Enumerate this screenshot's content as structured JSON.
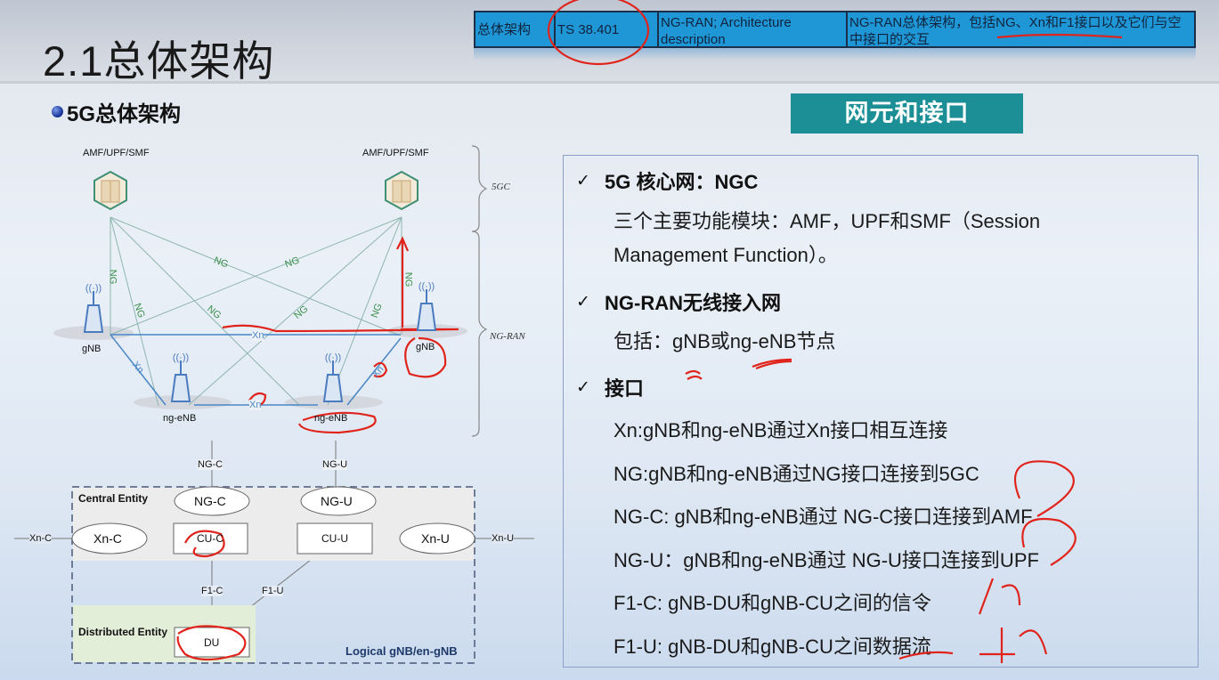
{
  "slide": {
    "title": "2.1总体架构",
    "subtitle": "5G总体架构"
  },
  "ref_table": {
    "cells": [
      "总体架构",
      "TS 38.401",
      "NG-RAN;  Architecture description",
      "NG-RAN总体架构，包括NG、Xn和F1接口以及它们与空中接口的交互"
    ],
    "color": "#1f97d6"
  },
  "section_badge": {
    "label": "网元和接口",
    "color": "#1b8e96"
  },
  "content": {
    "sections": [
      {
        "heading": "5G 核心网：NGC",
        "lines": [
          "三个主要功能模块：AMF，UPF和SMF（Session",
          "Management Function）。"
        ]
      },
      {
        "heading": "NG-RAN无线接入网",
        "lines": [
          "包括：gNB或ng-eNB节点"
        ]
      },
      {
        "heading": "接口",
        "lines": [
          "Xn:gNB和ng-eNB通过Xn接口相互连接",
          "NG:gNB和ng-eNB通过NG接口连接到5GC",
          "NG-C: gNB和ng-eNB通过 NG-C接口连接到AMF",
          "NG-U：gNB和ng-eNB通过 NG-U接口连接到UPF",
          "F1-C: gNB-DU和gNB-CU之间的信令",
          "F1-U: gNB-DU和gNB-CU之间数据流"
        ]
      }
    ],
    "check_icon": "✓"
  },
  "diagram_top": {
    "core_nodes": [
      "AMF/UPF/SMF",
      "AMF/UPF/SMF"
    ],
    "ran_nodes": [
      "gNB",
      "ng-eNB",
      "ng-eNB",
      "gNB"
    ],
    "ng_label": "NG",
    "xn_label": "Xn",
    "brace_labels": [
      "5GC",
      "NG-RAN"
    ]
  },
  "diagram_bottom": {
    "top_labels": [
      "NG-C",
      "NG-U"
    ],
    "central_entity": "Central Entity",
    "distributed_entity": "Distributed Entity",
    "ellipses": [
      "NG-C",
      "NG-U",
      "Xn-C",
      "Xn-U"
    ],
    "boxes": [
      "CU-C",
      "CU-U",
      "DU"
    ],
    "side_labels": [
      "Xn-C",
      "Xn-U"
    ],
    "links": [
      "F1-C",
      "F1-U"
    ],
    "container_label": "Logical gNB/en-gNB"
  }
}
